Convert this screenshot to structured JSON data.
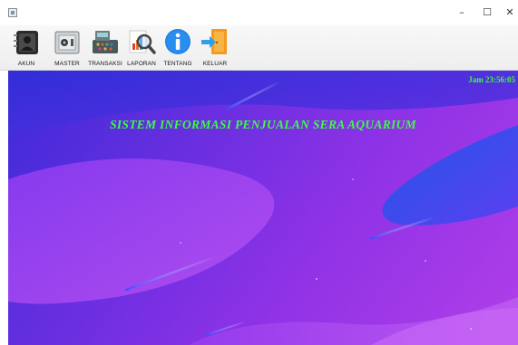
{
  "window": {
    "minimize": "–",
    "maximize": "☐",
    "close": "✕"
  },
  "toolbar": {
    "items": [
      {
        "label": "AKUN",
        "icon": "account-icon"
      },
      {
        "label": "MASTER",
        "icon": "safe-icon"
      },
      {
        "label": "TRANSAKSI",
        "icon": "cash-register-icon"
      },
      {
        "label": "LAPORAN",
        "icon": "report-magnifier-icon"
      },
      {
        "label": "TENTANG",
        "icon": "info-icon"
      },
      {
        "label": "KELUAR",
        "icon": "exit-door-icon"
      }
    ]
  },
  "main": {
    "clock": "Jam 23:56:05",
    "title": "SISTEM INFORMASI PENJUALAN SERA AQUARIUM"
  },
  "colors": {
    "accent_text": "#39ff3f",
    "background_start": "#3d2ad8",
    "background_end": "#b13fe8"
  }
}
